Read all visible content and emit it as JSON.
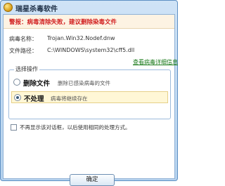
{
  "window": {
    "title": "瑞星杀毒软件"
  },
  "alert": {
    "text": "警报：病毒清除失败，建议删除染毒文件"
  },
  "details": {
    "virus_name_label": "病毒名称：",
    "virus_name_value": "Trojan.Win32.Nodef.dnw",
    "file_path_label": "文件路径：",
    "file_path_value": "C:\\WINDOWS\\system32\\cff5.dll",
    "details_link": "查看病毒详细信息"
  },
  "actions": {
    "group_label": "选择操作",
    "options": [
      {
        "title": "删除文件",
        "description": "删除已感染病毒的文件",
        "selected": false
      },
      {
        "title": "不处理",
        "description": "病毒将继续存在",
        "selected": true
      }
    ]
  },
  "remember": {
    "label": "不再显示该对话框，以后使用相同的处理方式。",
    "checked": false
  },
  "buttons": {
    "ok_label": "确定"
  },
  "colors": {
    "alert_text": "#d22222",
    "link": "#1a7a1a",
    "selected_row": "#fff7d6"
  }
}
